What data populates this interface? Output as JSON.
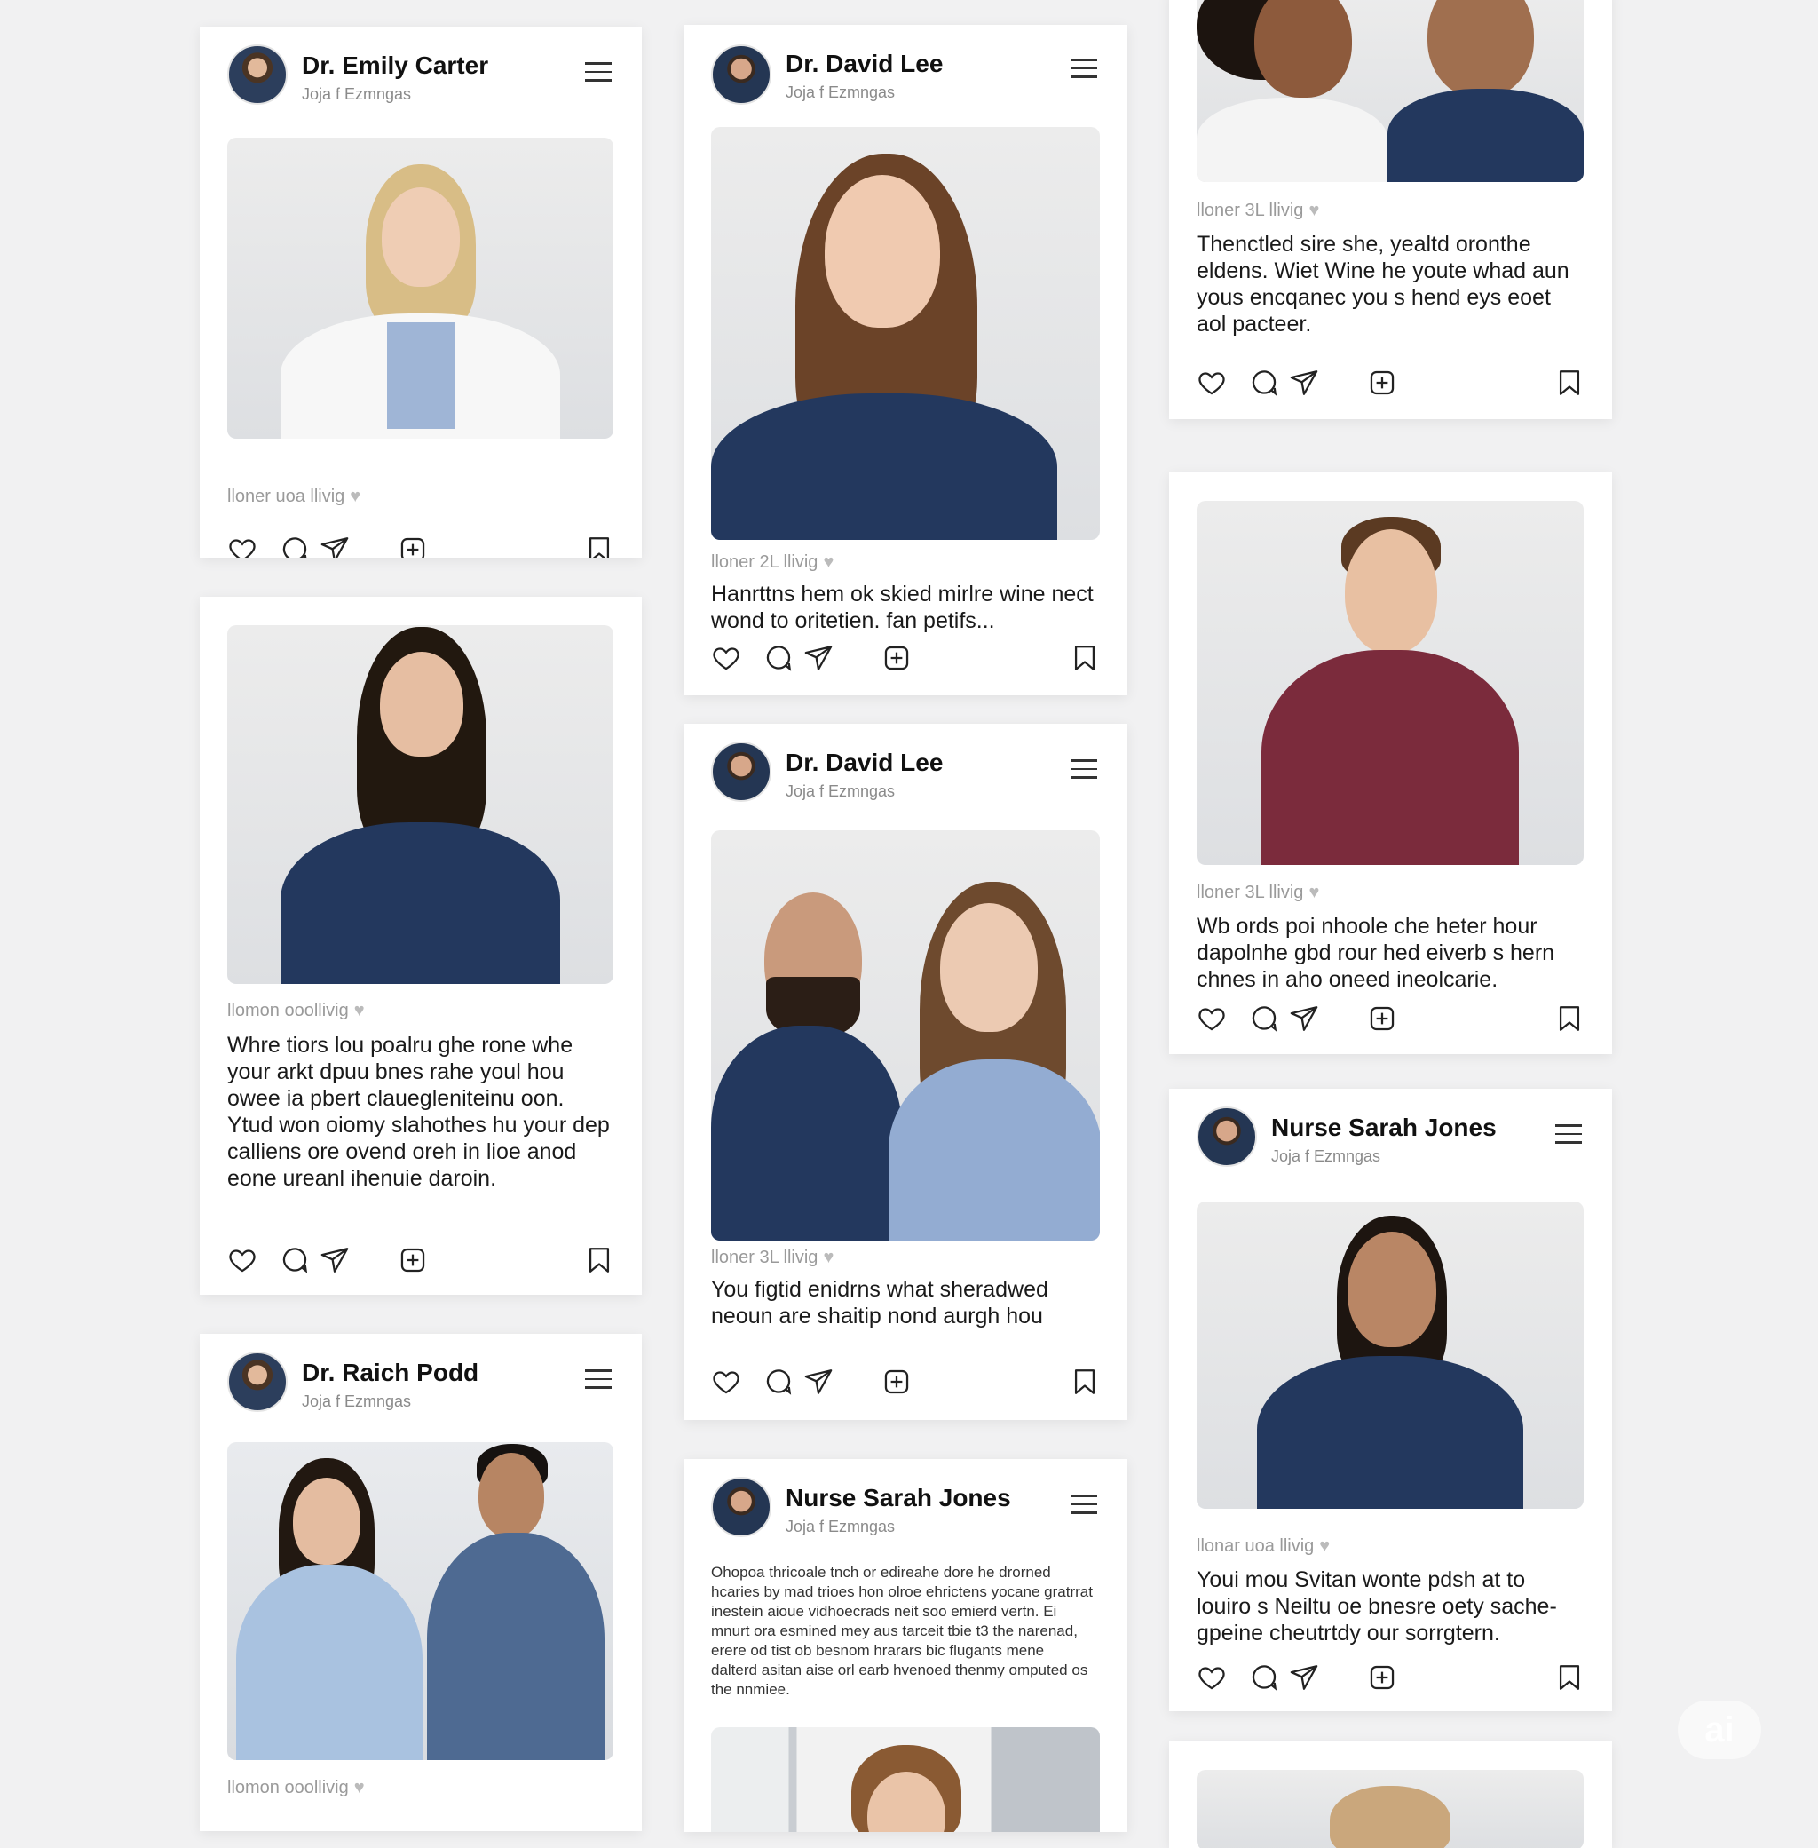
{
  "posts": [
    {
      "author": "Dr. Emily Carter",
      "subtitle": "Joja f Ezmngas",
      "likes": "lloner uoa llivig",
      "caption": "",
      "photo_alt": "female doctor in white coat"
    },
    {
      "author": "",
      "subtitle": "",
      "likes": "llomon ooollivig",
      "caption": "Whre tiors lou poalru ghe rone whe your arkt dpuu bnes rahe youl hou owee ia pbert clauegleniteinu oon. Ytud won oiomy slahothes hu your dep calliens ore ovend oreh in lioe anod eone ureanl ihenuie daroin.",
      "photo_alt": "female doctor in navy scrubs"
    },
    {
      "author": "Dr. Raich Podd",
      "subtitle": "Joja f Ezmngas",
      "likes": "llomon ooollivig",
      "caption": "",
      "photo_alt": "two healthcare workers"
    },
    {
      "author": "Dr. David Lee",
      "subtitle": "Joja f Ezmngas",
      "likes": "lloner 2L llivig",
      "caption": "Hanrttns hem ok skied mirlre wine nect wond to oritetien. fan petifs...",
      "photo_alt": "smiling woman in navy scrubs"
    },
    {
      "author": "Dr. David Lee",
      "subtitle": "Joja f Ezmngas",
      "likes": "lloner 3L llivig",
      "caption": "You figtid enidrns what sheradwed neoun are shaitip nond aurgh hou",
      "photo_alt": "two doctors in scrubs"
    },
    {
      "author": "Nurse Sarah Jones",
      "subtitle": "Joja f Ezmngas",
      "likes": "",
      "caption": "Ohopoa thricoale tnch or edireahe dore he drorned hcaries by mad trioes hon olroe ehrictens yocane gratrrat inestein aioue vidhoecrads neit soo emierd vertn. Ei mnurt ora esmined mey aus tarceit tbie t3 the narenad, erere od tist ob besnom hrarars bic flugants mene dalterd asitan aise orl earb hvenoed thenmy omputed os the nnmiee.",
      "photo_alt": "partial photo"
    },
    {
      "author": "",
      "subtitle": "",
      "likes": "lloner 3L llivig",
      "caption": "Thenctled sire she, yealtd oronthe eldens. Wiet Wine he youte whad aun yous encqanec you s hend eys eoet aol pacteer.",
      "photo_alt": "two doctors smiling"
    },
    {
      "author": "",
      "subtitle": "",
      "likes": "lloner 3L llivig",
      "caption": "Wb ords poi nhoole che heter hour dapolnhe gbd rour hed eiverb s hern chnes in aho oneed ineolcarie.",
      "photo_alt": "man in maroon polo"
    },
    {
      "author": "Nurse Sarah Jones",
      "subtitle": "Joja f Ezmngas",
      "likes": "llonar uoa llivig",
      "caption": "Youi mou Svitan wonte pdsh at to louiro s Neiltu oe bnesre oety sache-gpeine cheutrtdy our sorrgtern.",
      "photo_alt": "female nurse in navy scrubs"
    }
  ],
  "icons": {
    "like": "heart-outline",
    "comment": "speech-bubble",
    "send": "paper-plane",
    "add": "plus-square",
    "save": "bookmark",
    "menu": "hamburger"
  },
  "colors": {
    "background": "#f1f1f2",
    "card": "#ffffff",
    "scrubs": "#23385e",
    "text": "#111111"
  },
  "watermark": "ai"
}
